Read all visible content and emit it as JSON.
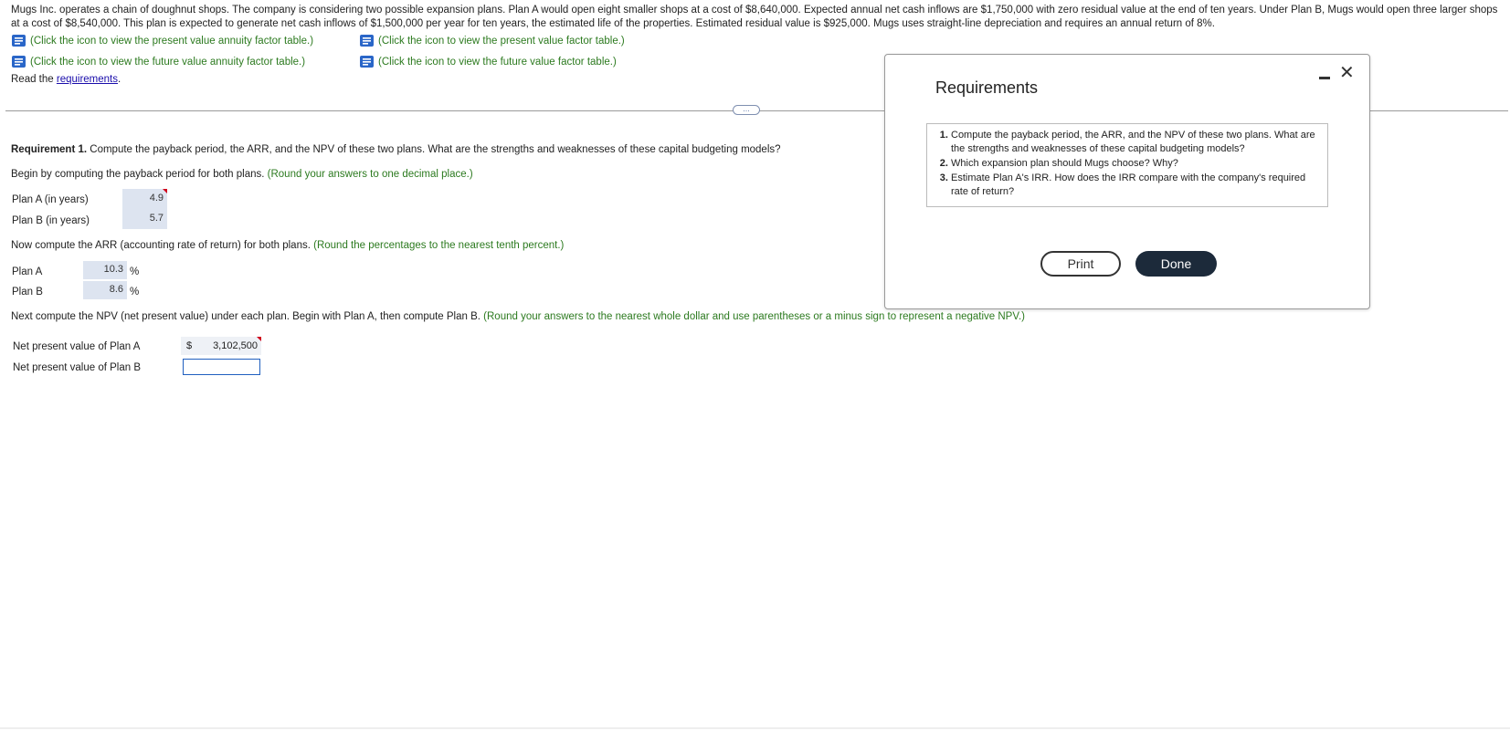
{
  "problem": {
    "text": "Mugs Inc. operates a chain of doughnut shops. The company is considering two possible expansion plans. Plan A would open eight smaller shops at a cost of $8,640,000. Expected annual net cash inflows are $1,750,000 with zero residual value at the end of ten years. Under Plan B, Mugs would open three larger shops at a cost of $8,540,000. This plan is expected to generate net cash inflows of $1,500,000 per year for ten years, the estimated life of the properties. Estimated residual value is $925,000. Mugs uses straight-line depreciation and requires an annual return of 8%."
  },
  "links": {
    "pv_annuity": "(Click the icon to view the present value annuity factor table.)",
    "pv_factor": "(Click the icon to view the present value factor table.)",
    "fv_annuity": "(Click the icon to view the future value annuity factor table.)",
    "fv_factor": "(Click the icon to view the future value factor table.)",
    "read_prefix": "Read the ",
    "read_link": "requirements",
    "read_suffix": "."
  },
  "handle": {
    "label": "…"
  },
  "req1": {
    "bold": "Requirement 1.",
    "text": " Compute the payback period, the ARR, and the NPV of these two plans. What are the strengths and weaknesses of these capital budgeting models?"
  },
  "payback": {
    "intro": "Begin by computing the payback period for both plans. ",
    "hint": "(Round your answers to one decimal place.)",
    "plan_a_label": "Plan A (in years)",
    "plan_a_value": "4.9",
    "plan_b_label": "Plan B (in years)",
    "plan_b_value": "5.7"
  },
  "arr": {
    "intro": "Now compute the ARR (accounting rate of return) for both plans. ",
    "hint": "(Round the percentages to the nearest tenth percent.)",
    "plan_a_label": "Plan A",
    "plan_a_value": "10.3",
    "plan_b_label": "Plan B",
    "plan_b_value": "8.6",
    "unit": "%"
  },
  "npv": {
    "intro": "Next compute the NPV (net present value) under each plan. Begin with Plan A, then compute Plan B. ",
    "hint": "(Round your answers to the nearest whole dollar and use parentheses or a minus sign to represent a negative NPV.)",
    "plan_a_label": "Net present value of Plan A",
    "currency": "$",
    "plan_a_value": "3,102,500",
    "plan_b_label": "Net present value of Plan B",
    "plan_b_value": ""
  },
  "modal": {
    "title": "Requirements",
    "items": [
      "Compute the payback period, the ARR, and the NPV of these two plans. What are the strengths and weaknesses of these capital budgeting models?",
      "Which expansion plan should Mugs choose? Why?",
      "Estimate Plan A's IRR. How does the IRR compare with the company's required rate of return?"
    ],
    "print_label": "Print",
    "done_label": "Done"
  },
  "colors": {
    "hint_green": "#2c7a1f",
    "link_blue": "#1a0dab",
    "answer_bg": "#dde4f0",
    "done_bg": "#1c2a3a"
  }
}
